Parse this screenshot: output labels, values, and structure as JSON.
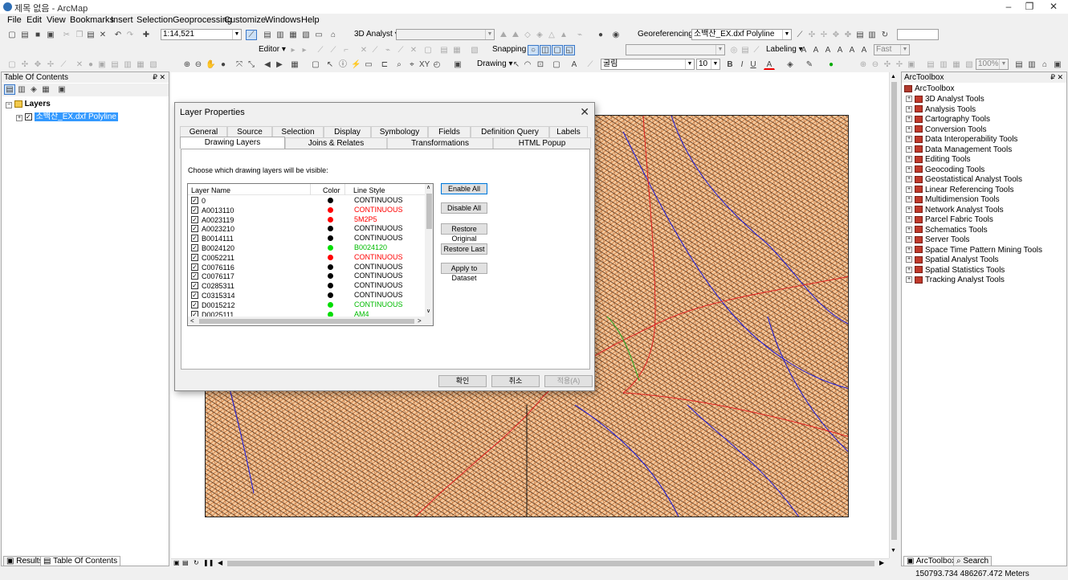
{
  "window": {
    "title": "제목 없음 - ArcMap"
  },
  "menu": [
    "File",
    "Edit",
    "View",
    "Bookmarks",
    "Insert",
    "Selection",
    "Geoprocessing",
    "Customize",
    "Windows",
    "Help"
  ],
  "toolbar": {
    "scale": "1:14,521",
    "analyst3d": "3D Analyst ▾",
    "editor": "Editor ▾",
    "snapping": "Snapping ▾",
    "georeferencing": "Georeferencing ▾",
    "georef_layer": "소백산_EX.dxf Polyline",
    "labeling": "Labeling ▾",
    "labeling_fast": "Fast",
    "drawing": "Drawing ▾",
    "font": "굴림",
    "font_size": "10",
    "zoom": "100%"
  },
  "toc": {
    "title": "Table Of Contents",
    "layers_label": "Layers",
    "layer_name": "소백산_EX.dxf Polyline"
  },
  "dialog": {
    "title": "Layer Properties",
    "tabs_row1": [
      "General",
      "Source",
      "Selection",
      "Display",
      "Symbology",
      "Fields",
      "Definition Query",
      "Labels"
    ],
    "tabs_row2": [
      "Drawing Layers",
      "Joins & Relates",
      "Transformations",
      "HTML Popup"
    ],
    "instruction": "Choose which drawing layers will be visible:",
    "columns": [
      "Layer Name",
      "Color",
      "Line Style"
    ],
    "layers": [
      {
        "name": "0",
        "color": "#000000",
        "style": "CONTINUOUS",
        "style_color": "#000000"
      },
      {
        "name": "A0013110",
        "color": "#ff0000",
        "style": "CONTINUOUS",
        "style_color": "#ff0000"
      },
      {
        "name": "A0023119",
        "color": "#ff0000",
        "style": "5M2P5",
        "style_color": "#ff0000"
      },
      {
        "name": "A0023210",
        "color": "#000000",
        "style": "CONTINUOUS",
        "style_color": "#000000"
      },
      {
        "name": "B0014111",
        "color": "#000000",
        "style": "CONTINUOUS",
        "style_color": "#000000"
      },
      {
        "name": "B0024120",
        "color": "#00dd00",
        "style": "B0024120",
        "style_color": "#00bb00"
      },
      {
        "name": "C0052211",
        "color": "#ff0000",
        "style": "CONTINUOUS",
        "style_color": "#ff0000"
      },
      {
        "name": "C0076116",
        "color": "#000000",
        "style": "CONTINUOUS",
        "style_color": "#000000"
      },
      {
        "name": "C0076117",
        "color": "#000000",
        "style": "CONTINUOUS",
        "style_color": "#000000"
      },
      {
        "name": "C0285311",
        "color": "#000000",
        "style": "CONTINUOUS",
        "style_color": "#000000"
      },
      {
        "name": "C0315314",
        "color": "#000000",
        "style": "CONTINUOUS",
        "style_color": "#000000"
      },
      {
        "name": "D0015212",
        "color": "#00dd00",
        "style": "CONTINUOUS",
        "style_color": "#00bb00"
      },
      {
        "name": "D0025111",
        "color": "#00dd00",
        "style": "AM4",
        "style_color": "#00bb00"
      }
    ],
    "side_buttons": [
      "Enable All",
      "Disable All",
      "Restore Original",
      "Restore Last",
      "Apply to Dataset"
    ],
    "ok": "확인",
    "cancel": "취소",
    "apply": "적용(A)"
  },
  "toolbox": {
    "title": "ArcToolbox",
    "root": "ArcToolbox",
    "items": [
      "3D Analyst Tools",
      "Analysis Tools",
      "Cartography Tools",
      "Conversion Tools",
      "Data Interoperability Tools",
      "Data Management Tools",
      "Editing Tools",
      "Geocoding Tools",
      "Geostatistical Analyst Tools",
      "Linear Referencing Tools",
      "Multidimension Tools",
      "Network Analyst Tools",
      "Parcel Fabric Tools",
      "Schematics Tools",
      "Server Tools",
      "Space Time Pattern Mining Tools",
      "Spatial Analyst Tools",
      "Spatial Statistics Tools",
      "Tracking Analyst Tools"
    ]
  },
  "bottom_tabs": {
    "results": "Results",
    "toc": "Table Of Contents",
    "arctoolbox": "ArcToolbox",
    "search": "Search"
  },
  "status": {
    "coords": "150793.734  486267.472 Meters"
  }
}
